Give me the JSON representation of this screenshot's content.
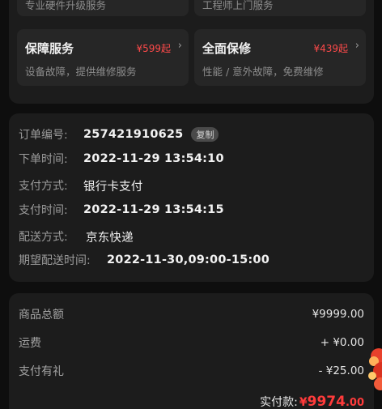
{
  "services": {
    "top_left": {
      "subtitle": "专业硬件升级服务"
    },
    "top_right": {
      "subtitle": "工程师上门服务"
    },
    "tiles": [
      {
        "title": "保障服务",
        "price": "¥599起",
        "subtitle": "设备故障，提供维修服务"
      },
      {
        "title": "全面保修",
        "price": "¥439起",
        "subtitle": "性能 / 意外故障，免费维修"
      }
    ],
    "arrow": "›"
  },
  "order": {
    "number_label": "订单编号:",
    "number_value": "257421910625",
    "copy_label": "复制",
    "order_time_label": "下单时间:",
    "order_time_value": "2022-11-29 13:54:10",
    "pay_method_label": "支付方式:",
    "pay_method_value": "银行卡支付",
    "pay_time_label": "支付时间:",
    "pay_time_value": "2022-11-29 13:54:15",
    "delivery_label": "配送方式:",
    "delivery_value": "京东快递",
    "expected_label": "期望配送时间:",
    "expected_value": "2022-11-30,09:00-15:00"
  },
  "summary": {
    "goods_total_label": "商品总额",
    "goods_total_value": "¥9999.00",
    "shipping_label": "运费",
    "shipping_value": "+ ¥0.00",
    "gift_label": "支付有礼",
    "gift_value": "- ¥25.00",
    "paid_label": "实付款:",
    "paid_currency": "¥",
    "paid_amount": "9974",
    "paid_decimal": ".00"
  },
  "colors": {
    "accent_red": "#ff3b3b",
    "card_bg": "#1c1c1c",
    "page_bg": "#0e0e0e"
  }
}
